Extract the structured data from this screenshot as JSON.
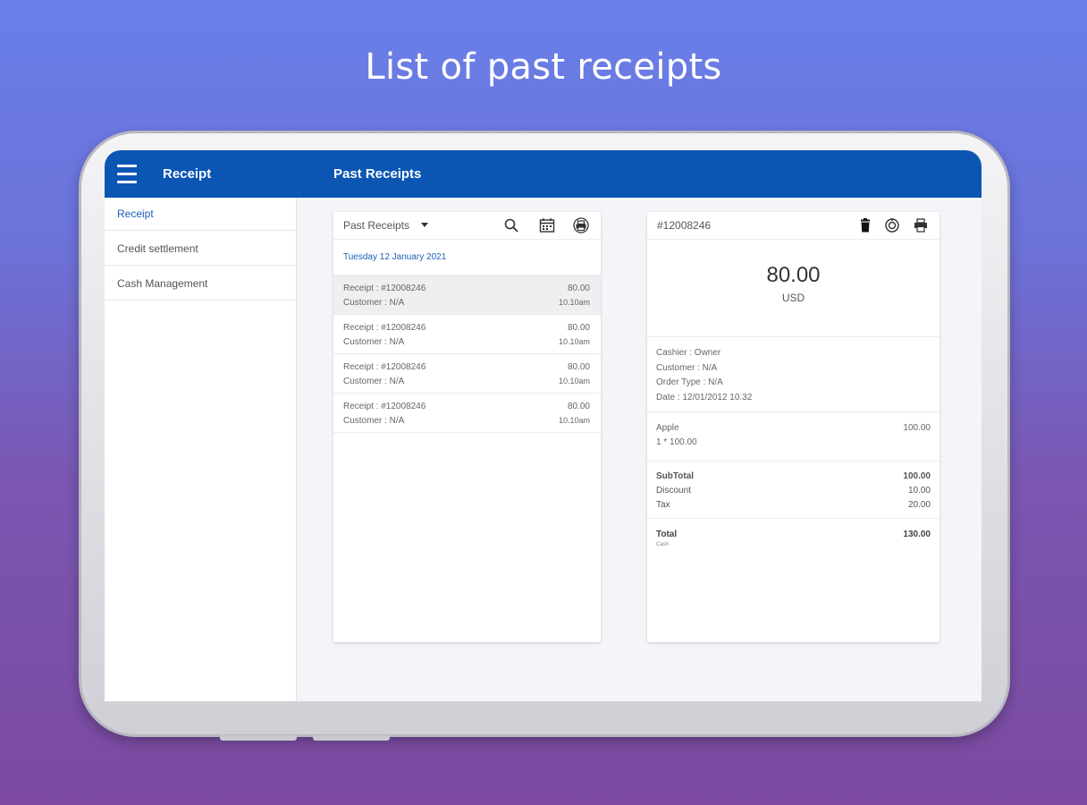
{
  "headline": "List of past receipts",
  "appbar": {
    "title": "Receipt",
    "page_title": "Past Receipts"
  },
  "sidebar": {
    "items": [
      {
        "label": "Receipt",
        "active": true
      },
      {
        "label": "Credit settlement",
        "active": false
      },
      {
        "label": "Cash Management",
        "active": false
      }
    ]
  },
  "list_panel": {
    "filter_label": "Past Receipts",
    "date_header": "Tuesday 12 January 2021",
    "receipts": [
      {
        "receipt": "Receipt : #12008246",
        "customer": "Customer :  N/A",
        "amount": "80.00",
        "time": "10.10am",
        "selected": true
      },
      {
        "receipt": "Receipt : #12008246",
        "customer": "Customer :  N/A",
        "amount": "80.00",
        "time": "10.10am",
        "selected": false
      },
      {
        "receipt": "Receipt : #12008246",
        "customer": "Customer :  N/A",
        "amount": "80.00",
        "time": "10.10am",
        "selected": false
      },
      {
        "receipt": "Receipt : #12008246",
        "customer": "Customer :  N/A",
        "amount": "80.00",
        "time": "10.10am",
        "selected": false
      }
    ]
  },
  "detail_panel": {
    "receipt_id": "#12008246",
    "amount": "80.00",
    "currency": "USD",
    "cashier": "Cashier : Owner",
    "customer": "Customer : N/A",
    "order_type": "Order Type : N/A",
    "date": "Date : 12/01/2012 10.32",
    "item_name": "Apple",
    "item_price": "100.00",
    "item_qty": "1 * 100.00",
    "subtotal_label": "SubTotal",
    "subtotal_value": "100.00",
    "discount_label": "Discount",
    "discount_value": "10.00",
    "tax_label": "Tax",
    "tax_value": "20.00",
    "total_label": "Total",
    "total_value": "130.00",
    "payment_note": "Cash"
  },
  "colors": {
    "brand": "#0b56b3",
    "accent_text": "#1d5fb8",
    "background_top": "#6a7fe9",
    "background_bottom": "#7b4aa0"
  },
  "icons": [
    "menu-icon",
    "search-icon",
    "calendar-icon",
    "print-icon",
    "delete-icon",
    "refund-icon"
  ]
}
